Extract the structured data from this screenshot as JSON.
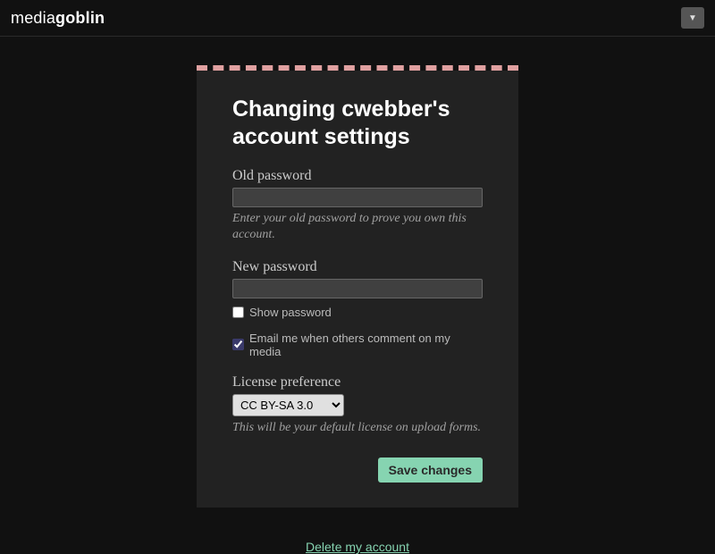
{
  "header": {
    "logo_plain": "media",
    "logo_bold": "goblin"
  },
  "page": {
    "title": "Changing cwebber's account settings"
  },
  "fields": {
    "old_password": {
      "label": "Old password",
      "value": "",
      "helper": "Enter your old password to prove you own this account."
    },
    "new_password": {
      "label": "New password",
      "value": ""
    },
    "show_password": {
      "label": "Show password",
      "checked": false
    },
    "email_comments": {
      "label": "Email me when others comment on my media",
      "checked": true
    },
    "license": {
      "label": "License preference",
      "selected": "CC BY-SA 3.0",
      "helper": "This will be your default license on upload forms."
    }
  },
  "buttons": {
    "save": "Save changes",
    "delete": "Delete my account"
  }
}
